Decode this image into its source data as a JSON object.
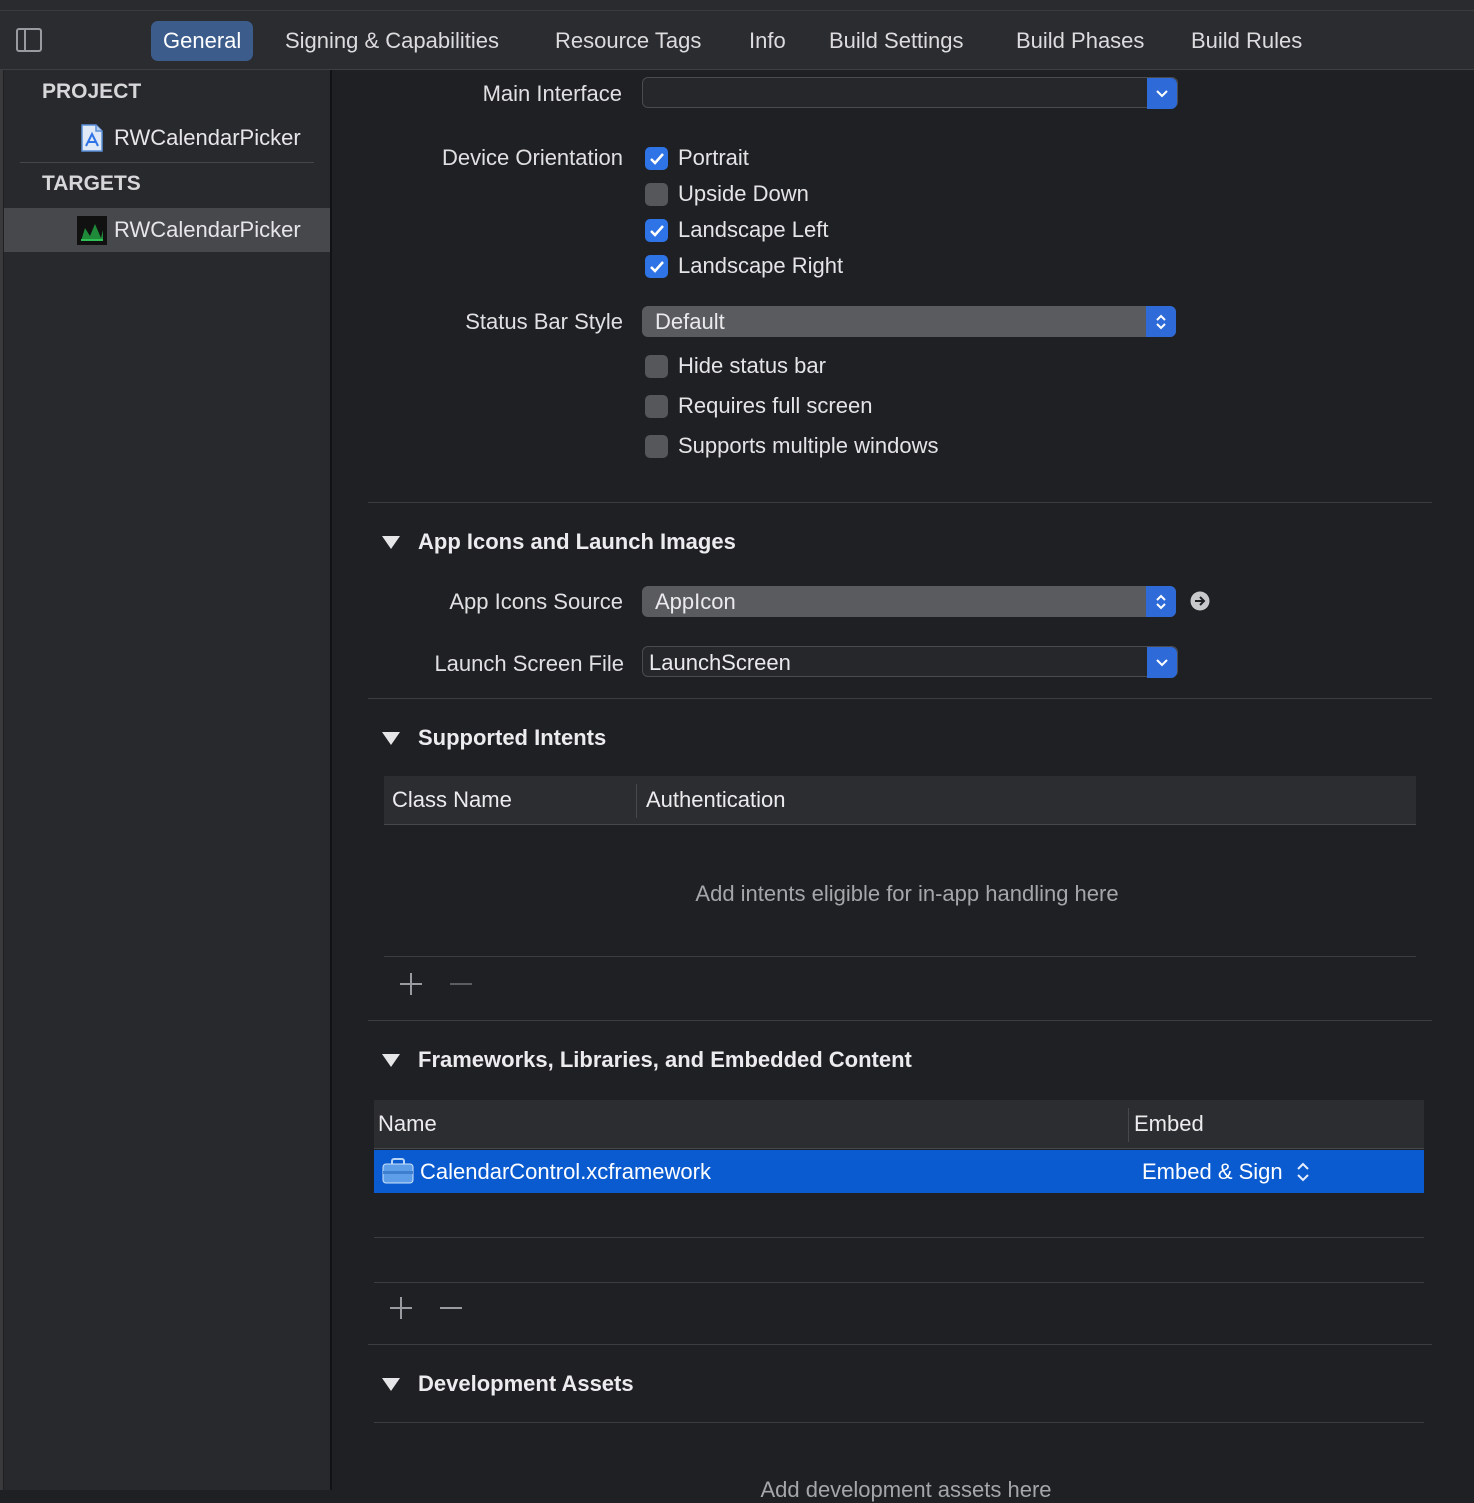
{
  "tabs": [
    "General",
    "Signing & Capabilities",
    "Resource Tags",
    "Info",
    "Build Settings",
    "Build Phases",
    "Build Rules"
  ],
  "sidebar": {
    "project_header": "PROJECT",
    "project_item": "RWCalendarPicker",
    "targets_header": "TARGETS",
    "target_item": "RWCalendarPicker"
  },
  "deployment": {
    "main_interface_label": "Main Interface",
    "main_interface_value": "",
    "device_orientation_label": "Device Orientation",
    "orientations": [
      {
        "label": "Portrait",
        "checked": true
      },
      {
        "label": "Upside Down",
        "checked": false
      },
      {
        "label": "Landscape Left",
        "checked": true
      },
      {
        "label": "Landscape Right",
        "checked": true
      }
    ],
    "status_bar_style_label": "Status Bar Style",
    "status_bar_style_value": "Default",
    "status_options": [
      {
        "label": "Hide status bar",
        "checked": false
      },
      {
        "label": "Requires full screen",
        "checked": false
      },
      {
        "label": "Supports multiple windows",
        "checked": false
      }
    ]
  },
  "app_icons": {
    "title": "App Icons and Launch Images",
    "source_label": "App Icons Source",
    "source_value": "AppIcon",
    "launch_label": "Launch Screen File",
    "launch_value": "LaunchScreen"
  },
  "intents": {
    "title": "Supported Intents",
    "col_class": "Class Name",
    "col_auth": "Authentication",
    "placeholder": "Add intents eligible for in-app handling here"
  },
  "frameworks": {
    "title": "Frameworks, Libraries, and Embedded Content",
    "col_name": "Name",
    "col_embed": "Embed",
    "rows": [
      {
        "name": "CalendarControl.xcframework",
        "embed": "Embed & Sign"
      }
    ]
  },
  "dev_assets": {
    "title": "Development Assets",
    "placeholder": "Add development assets here"
  },
  "controls": {
    "add": "+",
    "remove": "—"
  },
  "colors": {
    "accent": "#2f74e6",
    "selection": "#0a5bd0",
    "background": "#1f2023"
  }
}
